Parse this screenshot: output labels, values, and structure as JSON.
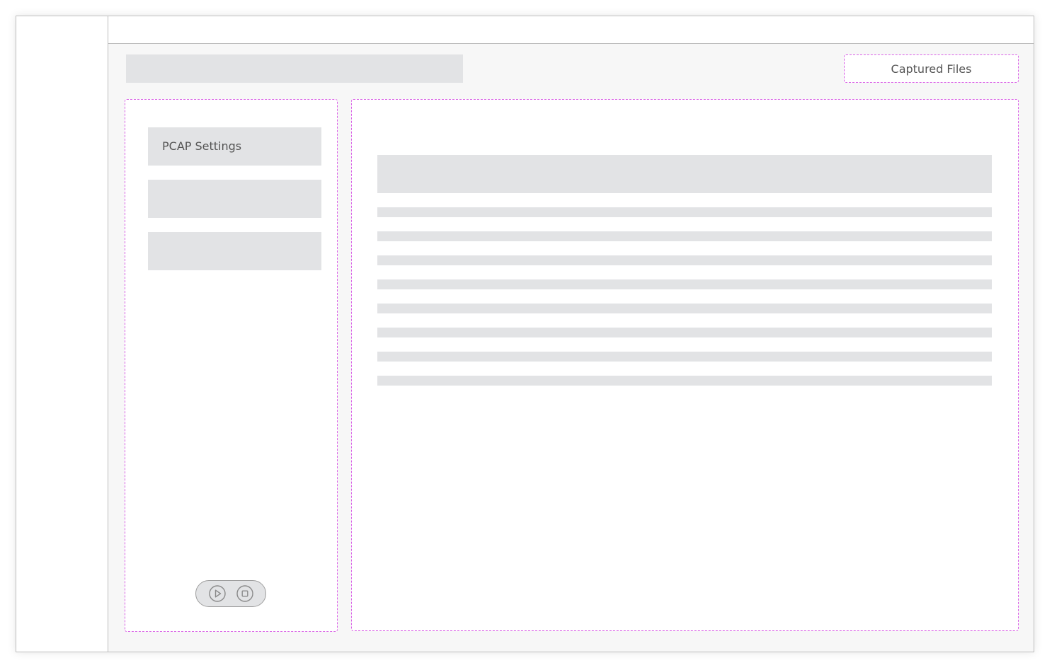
{
  "toolbar": {
    "captured_files_label": "Captured Files"
  },
  "sidebar": {
    "items": [
      {
        "label": "PCAP Settings"
      },
      {
        "label": ""
      },
      {
        "label": ""
      }
    ]
  },
  "controls": {
    "icons": [
      "play-icon",
      "stop-icon"
    ]
  },
  "colors": {
    "annotation_border": "#d95fe6",
    "placeholder_fill": "#e2e3e5",
    "text": "#555555"
  }
}
